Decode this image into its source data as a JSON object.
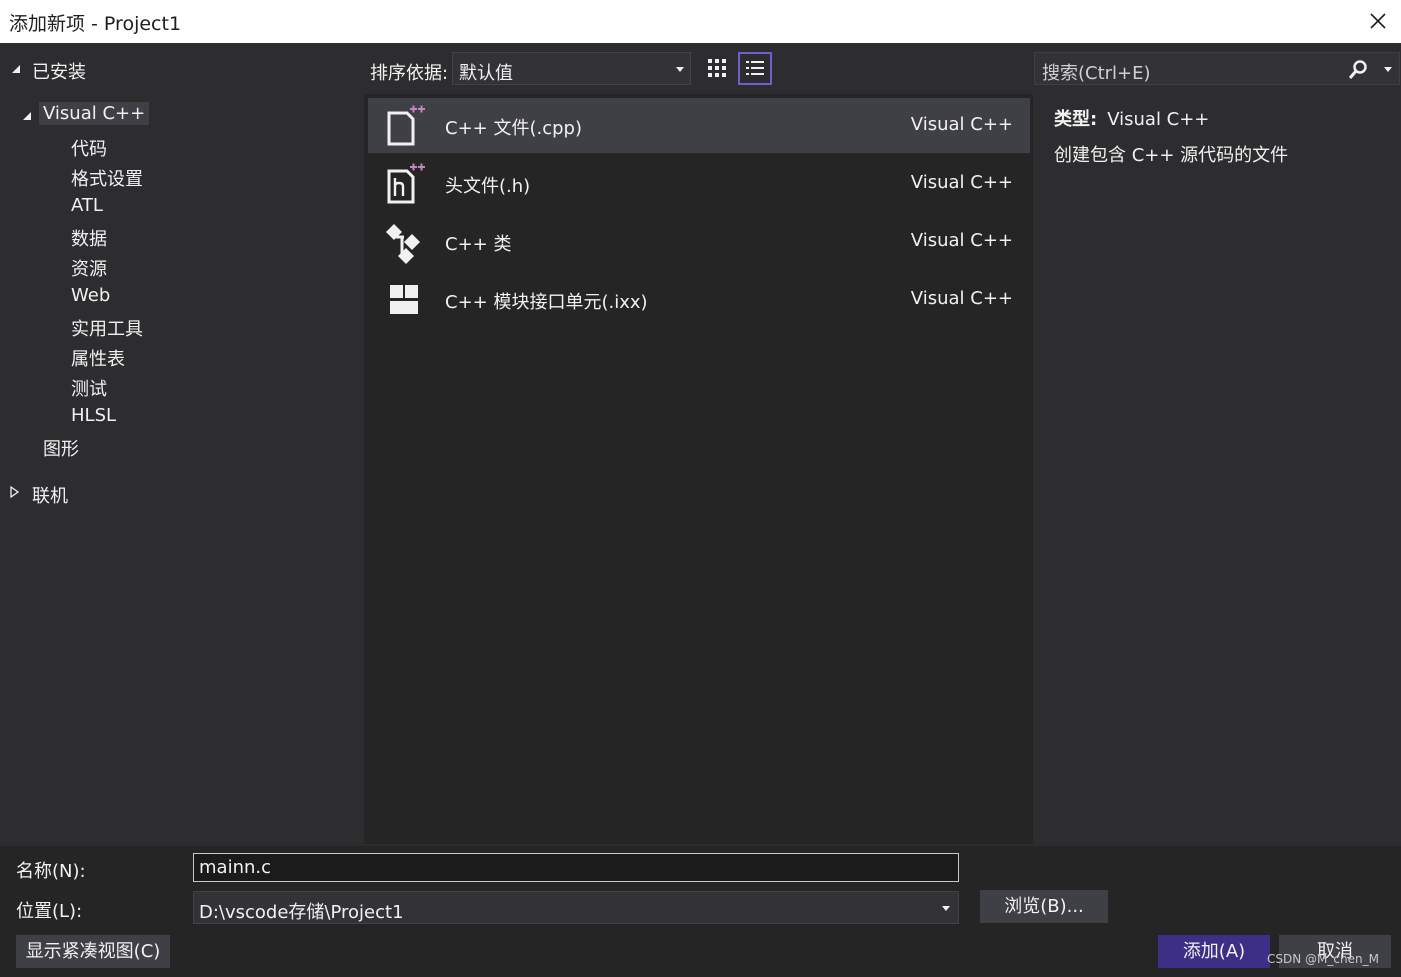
{
  "window": {
    "title": "添加新项 - Project1"
  },
  "tree": {
    "installed": "已安装",
    "visual_cpp": "Visual C++",
    "children": [
      "代码",
      "格式设置",
      "ATL",
      "数据",
      "资源",
      "Web",
      "实用工具",
      "属性表",
      "测试",
      "HLSL"
    ],
    "graphics": "图形",
    "online": "联机"
  },
  "toolbar": {
    "sort_label": "排序依据:",
    "sort_value": "默认值"
  },
  "templates": [
    {
      "name": "C++ 文件(.cpp)",
      "lang": "Visual C++",
      "icon": "cpp-file-icon",
      "selected": true
    },
    {
      "name": "头文件(.h)",
      "lang": "Visual C++",
      "icon": "header-file-icon",
      "selected": false
    },
    {
      "name": "C++ 类",
      "lang": "Visual C++",
      "icon": "class-icon",
      "selected": false
    },
    {
      "name": "C++ 模块接口单元(.ixx)",
      "lang": "Visual C++",
      "icon": "module-icon",
      "selected": false
    }
  ],
  "search": {
    "placeholder": "搜索(Ctrl+E)"
  },
  "details": {
    "type_label": "类型:",
    "type_value": "Visual C++",
    "description": "创建包含 C++ 源代码的文件"
  },
  "form": {
    "name_label": "名称(N):",
    "name_value": "mainn.c",
    "location_label": "位置(L):",
    "location_value": "D:\\vscode存储\\Project1",
    "browse_button": "浏览(B)...",
    "compact_view_button": "显示紧凑视图(C)",
    "add_button": "添加(A)",
    "cancel_button": "取消"
  },
  "watermark": "CSDN @M_chen_M",
  "colors": {
    "accent": "#6c5fd1",
    "primary_button": "#3d2f85",
    "background": "#2d2d30",
    "list_background": "#252526"
  }
}
